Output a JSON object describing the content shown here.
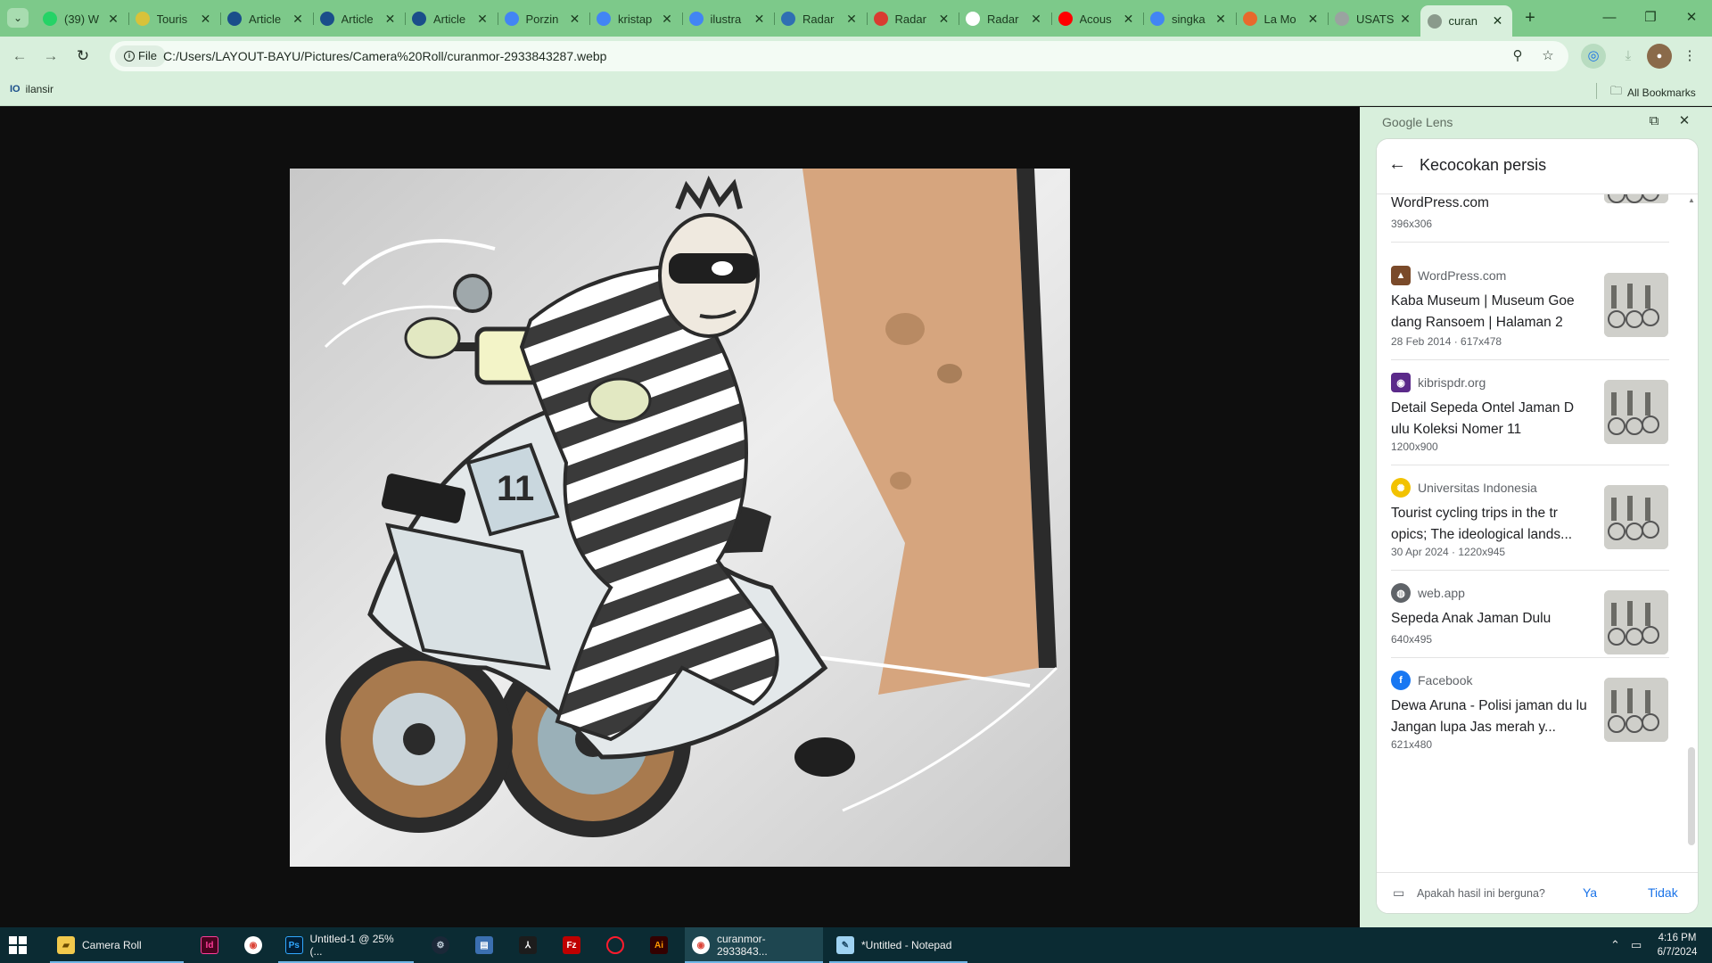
{
  "browser": {
    "tabs": [
      {
        "title": "(39) W",
        "icon": "whatsapp-icon",
        "color": "#25d366"
      },
      {
        "title": "Touris",
        "icon": "globe-yellow-icon",
        "color": "#d8c23a"
      },
      {
        "title": "Article",
        "icon": "ilansir-icon",
        "color": "#1a4e8a"
      },
      {
        "title": "Article",
        "icon": "ilansir-icon",
        "color": "#1a4e8a"
      },
      {
        "title": "Article",
        "icon": "ilansir-icon",
        "color": "#1a4e8a"
      },
      {
        "title": "Porzin",
        "icon": "google-icon",
        "color": "#4285f4"
      },
      {
        "title": "kristap",
        "icon": "google-icon",
        "color": "#4285f4"
      },
      {
        "title": "ilustra",
        "icon": "google-icon",
        "color": "#4285f4"
      },
      {
        "title": "Radar",
        "icon": "radar-icon",
        "color": "#2f6fb3"
      },
      {
        "title": "Radar",
        "icon": "radar-red-icon",
        "color": "#d93b30"
      },
      {
        "title": "Radar",
        "icon": "radar-r-icon",
        "color": "#ffffff"
      },
      {
        "title": "Acous",
        "icon": "youtube-icon",
        "color": "#ff0000"
      },
      {
        "title": "singka",
        "icon": "google-icon",
        "color": "#4285f4"
      },
      {
        "title": "La Mo",
        "icon": "lamo-icon",
        "color": "#e8692c"
      },
      {
        "title": "USATS",
        "icon": "globe-gray-icon",
        "color": "#9aa3a0"
      },
      {
        "title": "curan",
        "icon": "globe-icon",
        "color": "#8a9a8c"
      }
    ],
    "address": {
      "scheme_label": "File",
      "url": "C:/Users/LAYOUT-BAYU/Pictures/Camera%20Roll/curanmor-2933843287.webp"
    },
    "bookmarks": {
      "items": [
        {
          "label": "ilansir",
          "logo": "IO"
        }
      ],
      "all_label": "All Bookmarks"
    }
  },
  "lens": {
    "panel_title": "Google Lens",
    "heading": "Kecocokan persis",
    "results": [
      {
        "source": "",
        "title": "WordPress.com",
        "meta": "396x306",
        "source_icon": "",
        "source_color": ""
      },
      {
        "source": "WordPress.com",
        "title": "Kaba Museum | Museum Goe dang Ransoem | Halaman 2",
        "meta": "28 Feb 2014 · 617x478",
        "source_icon": "wordpress-site-icon",
        "source_color": "#7a4a2a"
      },
      {
        "source": "kibrispdr.org",
        "title": "Detail Sepeda Ontel Jaman D ulu Koleksi Nomer 11",
        "meta": "1200x900",
        "source_icon": "kibrispdr-icon",
        "source_color": "#5b2a8a"
      },
      {
        "source": "Universitas Indonesia",
        "title": "Tourist cycling trips in the tr opics; The ideological lands...",
        "meta": "30 Apr 2024 · 1220x945",
        "source_icon": "ui-makara-icon",
        "source_color": "#f2c200"
      },
      {
        "source": "web.app",
        "title": "Sepeda Anak Jaman Dulu",
        "meta": "640x495",
        "source_icon": "globe-icon",
        "source_color": "#5f6368"
      },
      {
        "source": "Facebook",
        "title": "Dewa Aruna - Polisi jaman du lu Jangan lupa Jas merah y...",
        "meta": "621x480",
        "source_icon": "facebook-icon",
        "source_color": "#1877f2"
      }
    ],
    "feedback": {
      "question": "Apakah hasil ini berguna?",
      "yes": "Ya",
      "no": "Tidak"
    }
  },
  "taskbar": {
    "camera_roll_label": "Camera Roll",
    "photoshop_label": "Untitled-1 @ 25% (...",
    "chrome_label": "curanmor-2933843...",
    "notepad_label": "*Untitled - Notepad",
    "pinned_icons": [
      "indesign-icon",
      "chrome-icon",
      "photoshop-icon",
      "steam-icon",
      "file-explorer-icon",
      "acrobat-icon",
      "filezilla-icon",
      "opera-icon",
      "illustrator-icon"
    ],
    "clock": {
      "time": "4:16 PM",
      "date": "6/7/2024"
    }
  },
  "colors": {
    "chrome_green": "#7dc98a",
    "toolbar_green": "#d8efdc",
    "link_blue": "#1a73e8",
    "taskbar": "#0b2b33"
  }
}
